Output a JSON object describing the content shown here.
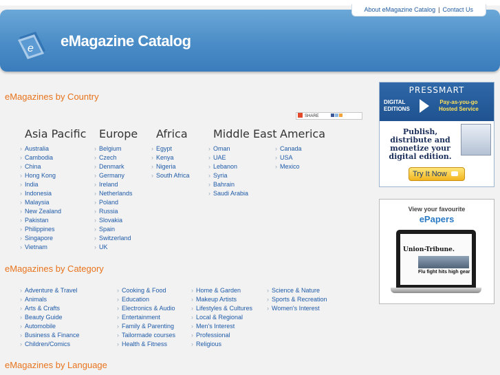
{
  "top_links": {
    "about": "About eMagazine Catalog",
    "sep": "|",
    "contact": "Contact Us"
  },
  "brand": {
    "title": "eMagazine Catalog",
    "icon_letter": "e"
  },
  "sections": {
    "country": "eMagazines by Country",
    "category": "eMagazines by Category",
    "language": "eMagazines by Language"
  },
  "share": {
    "label": "SHARE"
  },
  "regions": {
    "asia": {
      "name": "Asia Pacific",
      "items": [
        "Australia",
        "Cambodia",
        "China",
        "Hong Kong",
        "India",
        "Indonesia",
        "Malaysia",
        "New Zealand",
        "Pakistan",
        "Philippines",
        "Singapore",
        "Vietnam"
      ]
    },
    "europe": {
      "name": "Europe",
      "items": [
        "Belgium",
        "Czech",
        "Denmark",
        "Germany",
        "Ireland",
        "Netherlands",
        "Poland",
        "Russia",
        "Slovakia",
        "Spain",
        "Switzerland",
        "UK"
      ]
    },
    "africa": {
      "name": "Africa",
      "items": [
        "Egypt",
        "Kenya",
        "Nigeria",
        "South Africa"
      ]
    },
    "middle_east": {
      "name": "Middle East",
      "items": [
        "Oman",
        "UAE",
        "Lebanon",
        "Syria",
        "Bahrain",
        "Saudi Arabia"
      ]
    },
    "america": {
      "name": "America",
      "items": [
        "Canada",
        "USA",
        "Mexico"
      ]
    }
  },
  "categories": {
    "col1": [
      "Adventure & Travel",
      "Animals",
      "Arts & Crafts",
      "Beauty Guide",
      "Automobile",
      "Business & Finance",
      "Children/Comics"
    ],
    "col2": [
      "Cooking & Food",
      "Education",
      "Electronics & Audio",
      "Entertainment",
      "Family & Parenting",
      "Tailormade courses",
      "Health & Fitness"
    ],
    "col3": [
      "Home & Garden",
      "Makeup Artists",
      "Lifestyles & Cultures",
      "Local & Regional",
      "Men's Interest",
      "Professional",
      "Religious"
    ],
    "col4": [
      "Science & Nature",
      "Sports & Recreation",
      "Women's Interest"
    ]
  },
  "ad_pressmart": {
    "logo": "PRESSMART",
    "digital": "DIGITAL",
    "editions": "EDITIONS",
    "pay1": "Pay-as-you-go",
    "pay2": "Hosted Service",
    "publish": "Publish, distribute and monetize your digital edition.",
    "button": "Try It Now"
  },
  "ad_epapers": {
    "line1": "View your favourite",
    "line2": "ePapers",
    "newspaper": "Union-Tribune.",
    "headline": "Flu fight hits high gear"
  },
  "colors": {
    "accent": "#e8731c",
    "link": "#1e5aa8",
    "banner": "#4a8cc6"
  }
}
